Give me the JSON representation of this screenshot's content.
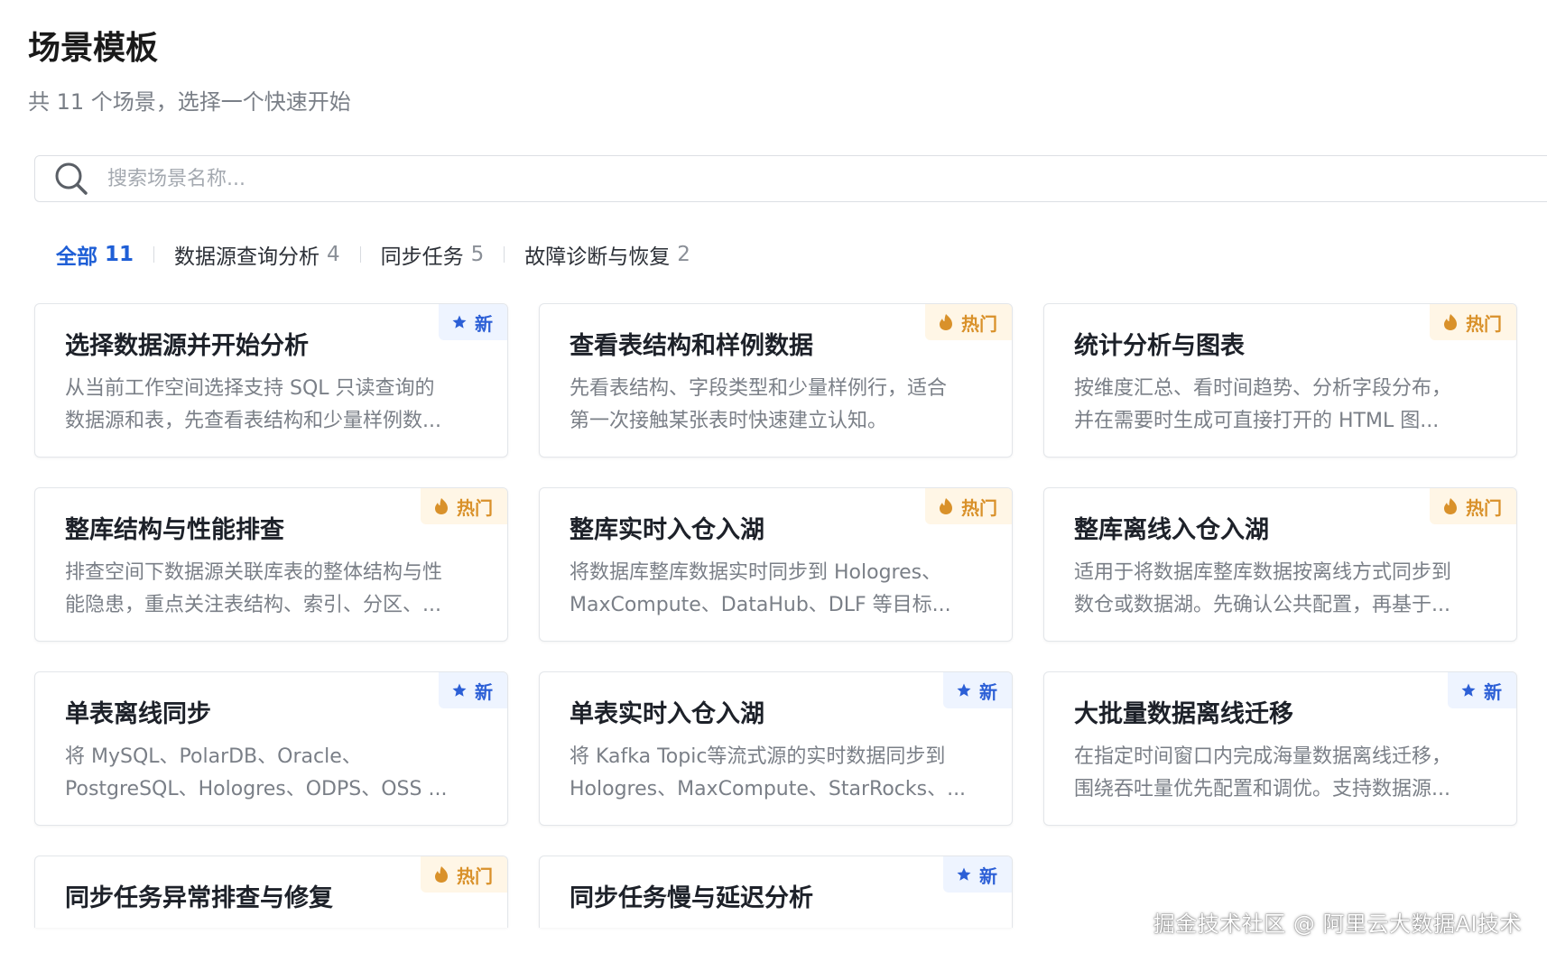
{
  "header": {
    "title": "场景模板",
    "subtitle": "共 11 个场景，选择一个快速开始"
  },
  "search": {
    "placeholder": "搜索场景名称...",
    "value": "",
    "icon": "search-icon"
  },
  "tabs": [
    {
      "label": "全部",
      "count": "11",
      "active": true
    },
    {
      "label": "数据源查询分析",
      "count": "4",
      "active": false
    },
    {
      "label": "同步任务",
      "count": "5",
      "active": false
    },
    {
      "label": "故障诊断与恢复",
      "count": "2",
      "active": false
    }
  ],
  "badges": {
    "new": {
      "label": "新",
      "icon": "star-icon",
      "color": "#2c5fd6",
      "bg": "#eef4ff"
    },
    "hot": {
      "label": "热门",
      "icon": "flame-icon",
      "color": "#d9912a",
      "bg": "#fff6e6"
    }
  },
  "cards": [
    {
      "title": "选择数据源并开始分析",
      "badge": "new",
      "desc_lines": [
        "从当前工作空间选择支持 SQL 只读查询的",
        "数据源和表，先查看表结构和少量样例数..."
      ]
    },
    {
      "title": "查看表结构和样例数据",
      "badge": "hot",
      "desc_lines": [
        "先看表结构、字段类型和少量样例行，适合",
        "第一次接触某张表时快速建立认知。"
      ]
    },
    {
      "title": "统计分析与图表",
      "badge": "hot",
      "desc_lines": [
        "按维度汇总、看时间趋势、分析字段分布，",
        "并在需要时生成可直接打开的 HTML 图..."
      ]
    },
    {
      "title": "整库结构与性能排查",
      "badge": "hot",
      "desc_lines": [
        "排查空间下数据源关联库表的整体结构与性",
        "能隐患，重点关注表结构、索引、分区、..."
      ]
    },
    {
      "title": "整库实时入仓入湖",
      "badge": "hot",
      "desc_lines": [
        "将数据库整库数据实时同步到 Hologres、",
        "MaxCompute、DataHub、DLF 等目标..."
      ]
    },
    {
      "title": "整库离线入仓入湖",
      "badge": "hot",
      "desc_lines": [
        "适用于将数据库整库数据按离线方式同步到",
        "数仓或数据湖。先确认公共配置，再基于..."
      ]
    },
    {
      "title": "单表离线同步",
      "badge": "new",
      "desc_lines": [
        "将 MySQL、PolarDB、Oracle、",
        "PostgreSQL、Hologres、ODPS、OSS ..."
      ]
    },
    {
      "title": "单表实时入仓入湖",
      "badge": "new",
      "desc_lines": [
        "将 Kafka Topic等流式源的实时数据同步到",
        "Hologres、MaxCompute、StarRocks、..."
      ]
    },
    {
      "title": "大批量数据离线迁移",
      "badge": "new",
      "desc_lines": [
        "在指定时间窗口内完成海量数据离线迁移，",
        "围绕吞吐量优先配置和调优。支持数据源..."
      ]
    },
    {
      "title": "同步任务异常排查与修复",
      "badge": "hot",
      "desc_lines": []
    },
    {
      "title": "同步任务慢与延迟分析",
      "badge": "new",
      "desc_lines": []
    }
  ],
  "watermark": "掘金技术社区 @ 阿里云大数据AI技术"
}
